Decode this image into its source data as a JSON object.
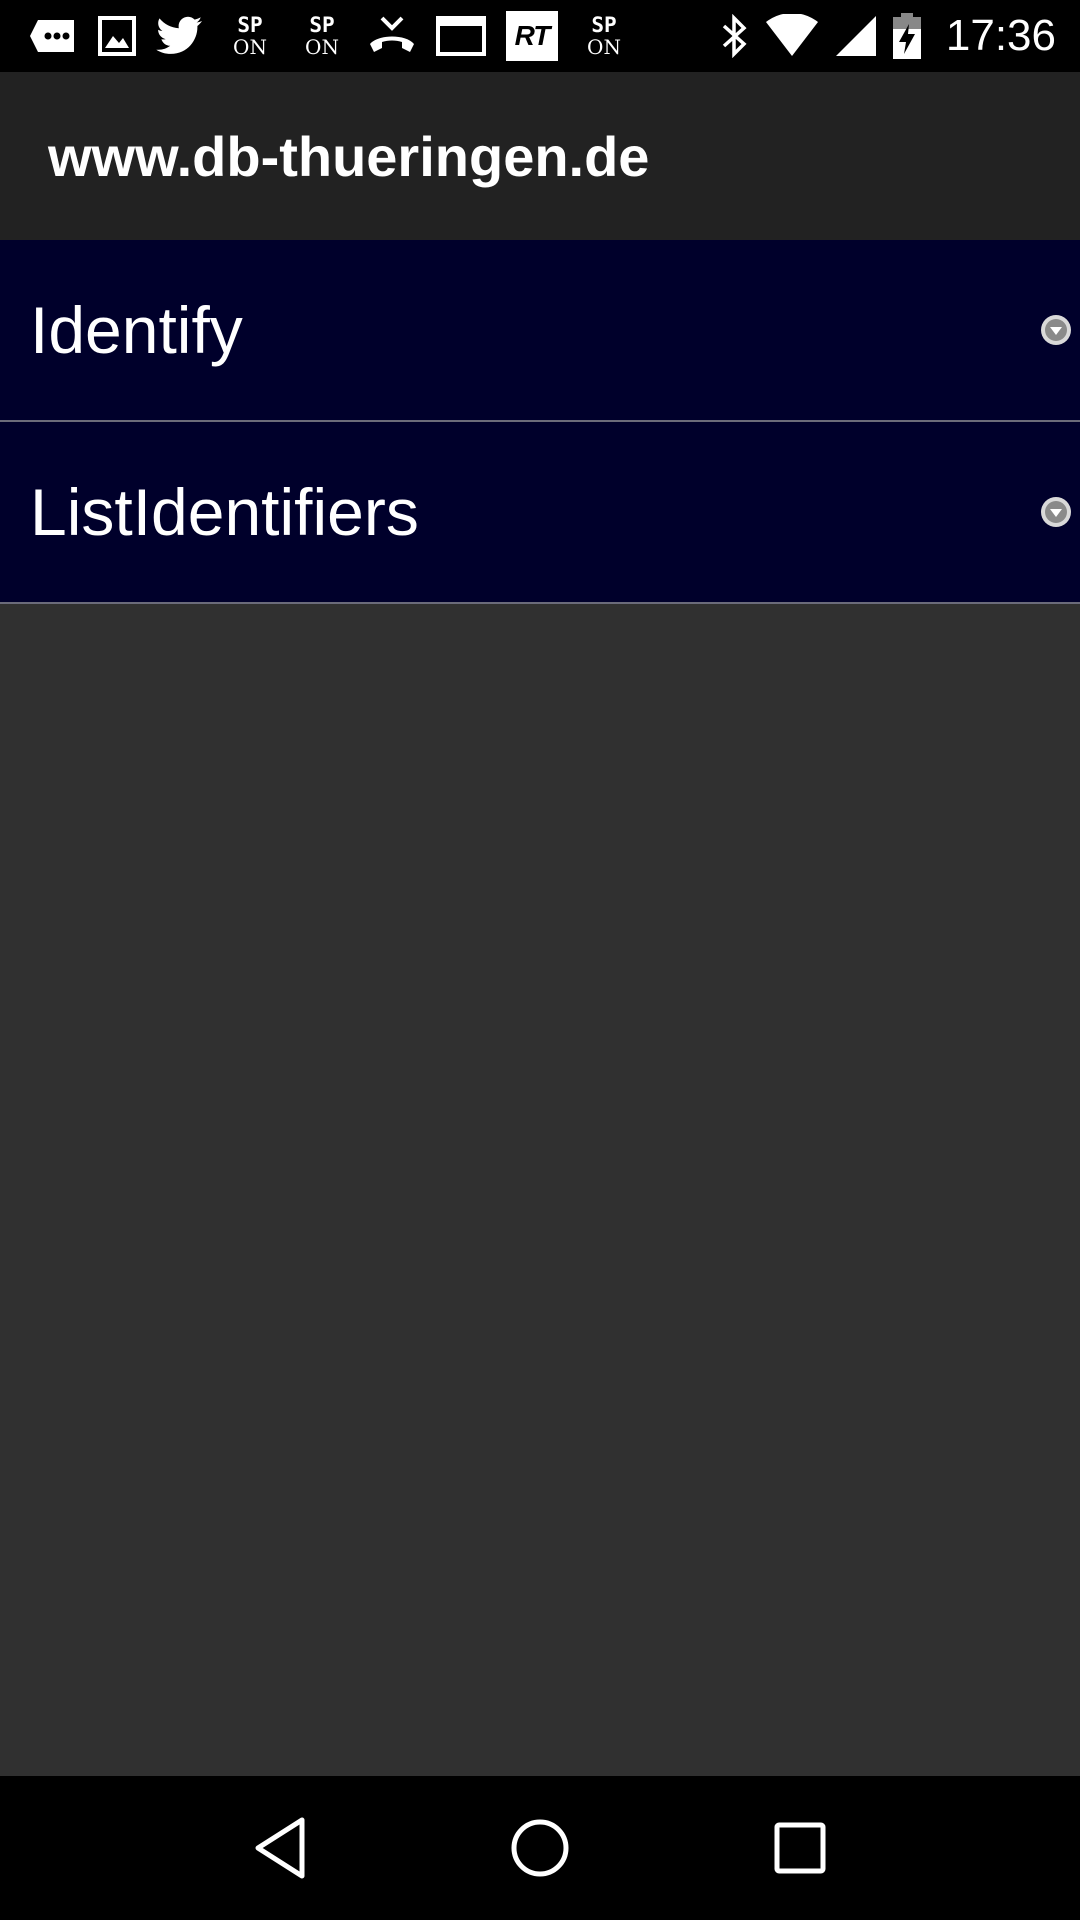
{
  "status_bar": {
    "time": "17:36",
    "notification_icons": [
      "message-icon",
      "image-icon",
      "twitter-icon",
      "sp-on-badge",
      "sp-on-badge",
      "missed-call-icon",
      "window-icon",
      "rt-badge",
      "sp-on-badge"
    ],
    "sp_top": "SP",
    "sp_bottom": "ON",
    "rt_label": "RT",
    "system_icons": [
      "bluetooth-icon",
      "wifi-icon",
      "cell-signal-icon",
      "battery-charging-icon"
    ]
  },
  "title_bar": {
    "title": "www.db-thueringen.de"
  },
  "list": {
    "items": [
      {
        "label": "Identify",
        "icon": "dropdown-icon"
      },
      {
        "label": "ListIdentifiers",
        "icon": "dropdown-icon"
      }
    ]
  },
  "nav_bar": {
    "buttons": [
      "back-icon",
      "home-icon",
      "recents-icon"
    ]
  },
  "colors": {
    "list_item_bg": "#00002b",
    "title_bar_bg": "#222222",
    "content_bg": "#303030",
    "status_bar_bg": "#000000"
  }
}
